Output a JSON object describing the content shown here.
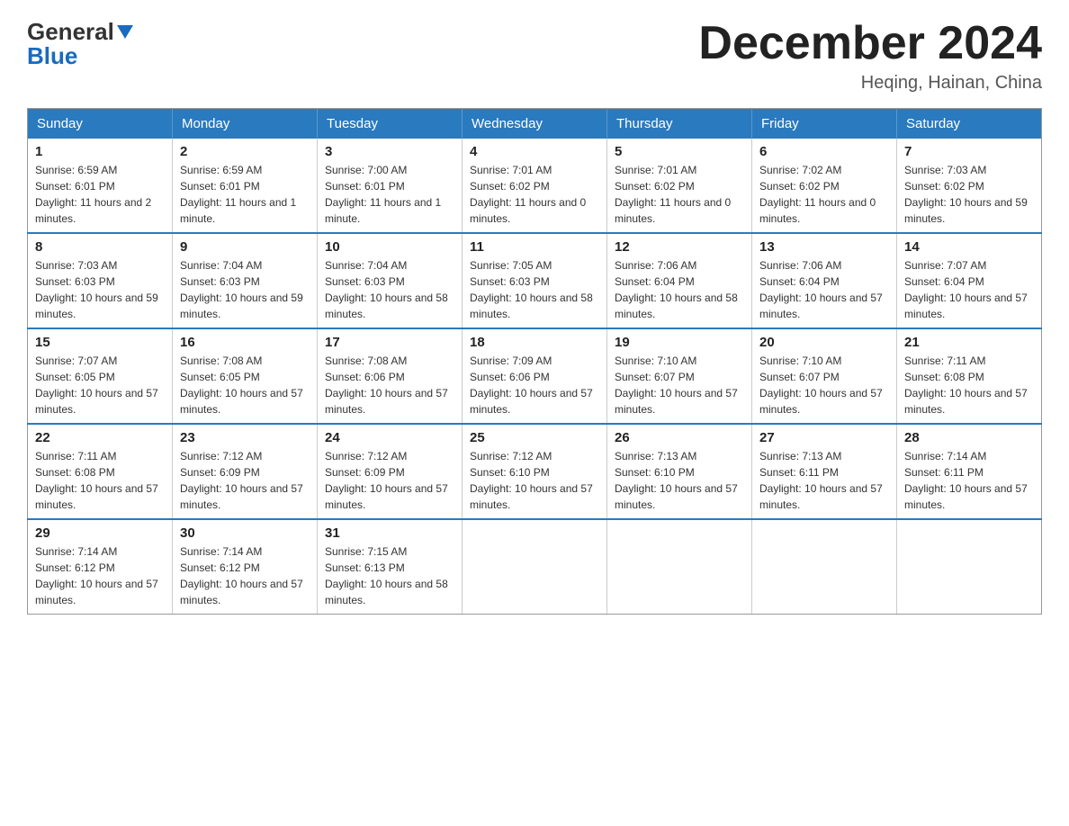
{
  "logo": {
    "line1_black": "General",
    "line1_blue_triangle": "▶",
    "line2": "Blue"
  },
  "title": "December 2024",
  "subtitle": "Heqing, Hainan, China",
  "days_of_week": [
    "Sunday",
    "Monday",
    "Tuesday",
    "Wednesday",
    "Thursday",
    "Friday",
    "Saturday"
  ],
  "weeks": [
    [
      {
        "day": "1",
        "sunrise": "6:59 AM",
        "sunset": "6:01 PM",
        "daylight": "11 hours and 2 minutes."
      },
      {
        "day": "2",
        "sunrise": "6:59 AM",
        "sunset": "6:01 PM",
        "daylight": "11 hours and 1 minute."
      },
      {
        "day": "3",
        "sunrise": "7:00 AM",
        "sunset": "6:01 PM",
        "daylight": "11 hours and 1 minute."
      },
      {
        "day": "4",
        "sunrise": "7:01 AM",
        "sunset": "6:02 PM",
        "daylight": "11 hours and 0 minutes."
      },
      {
        "day": "5",
        "sunrise": "7:01 AM",
        "sunset": "6:02 PM",
        "daylight": "11 hours and 0 minutes."
      },
      {
        "day": "6",
        "sunrise": "7:02 AM",
        "sunset": "6:02 PM",
        "daylight": "11 hours and 0 minutes."
      },
      {
        "day": "7",
        "sunrise": "7:03 AM",
        "sunset": "6:02 PM",
        "daylight": "10 hours and 59 minutes."
      }
    ],
    [
      {
        "day": "8",
        "sunrise": "7:03 AM",
        "sunset": "6:03 PM",
        "daylight": "10 hours and 59 minutes."
      },
      {
        "day": "9",
        "sunrise": "7:04 AM",
        "sunset": "6:03 PM",
        "daylight": "10 hours and 59 minutes."
      },
      {
        "day": "10",
        "sunrise": "7:04 AM",
        "sunset": "6:03 PM",
        "daylight": "10 hours and 58 minutes."
      },
      {
        "day": "11",
        "sunrise": "7:05 AM",
        "sunset": "6:03 PM",
        "daylight": "10 hours and 58 minutes."
      },
      {
        "day": "12",
        "sunrise": "7:06 AM",
        "sunset": "6:04 PM",
        "daylight": "10 hours and 58 minutes."
      },
      {
        "day": "13",
        "sunrise": "7:06 AM",
        "sunset": "6:04 PM",
        "daylight": "10 hours and 57 minutes."
      },
      {
        "day": "14",
        "sunrise": "7:07 AM",
        "sunset": "6:04 PM",
        "daylight": "10 hours and 57 minutes."
      }
    ],
    [
      {
        "day": "15",
        "sunrise": "7:07 AM",
        "sunset": "6:05 PM",
        "daylight": "10 hours and 57 minutes."
      },
      {
        "day": "16",
        "sunrise": "7:08 AM",
        "sunset": "6:05 PM",
        "daylight": "10 hours and 57 minutes."
      },
      {
        "day": "17",
        "sunrise": "7:08 AM",
        "sunset": "6:06 PM",
        "daylight": "10 hours and 57 minutes."
      },
      {
        "day": "18",
        "sunrise": "7:09 AM",
        "sunset": "6:06 PM",
        "daylight": "10 hours and 57 minutes."
      },
      {
        "day": "19",
        "sunrise": "7:10 AM",
        "sunset": "6:07 PM",
        "daylight": "10 hours and 57 minutes."
      },
      {
        "day": "20",
        "sunrise": "7:10 AM",
        "sunset": "6:07 PM",
        "daylight": "10 hours and 57 minutes."
      },
      {
        "day": "21",
        "sunrise": "7:11 AM",
        "sunset": "6:08 PM",
        "daylight": "10 hours and 57 minutes."
      }
    ],
    [
      {
        "day": "22",
        "sunrise": "7:11 AM",
        "sunset": "6:08 PM",
        "daylight": "10 hours and 57 minutes."
      },
      {
        "day": "23",
        "sunrise": "7:12 AM",
        "sunset": "6:09 PM",
        "daylight": "10 hours and 57 minutes."
      },
      {
        "day": "24",
        "sunrise": "7:12 AM",
        "sunset": "6:09 PM",
        "daylight": "10 hours and 57 minutes."
      },
      {
        "day": "25",
        "sunrise": "7:12 AM",
        "sunset": "6:10 PM",
        "daylight": "10 hours and 57 minutes."
      },
      {
        "day": "26",
        "sunrise": "7:13 AM",
        "sunset": "6:10 PM",
        "daylight": "10 hours and 57 minutes."
      },
      {
        "day": "27",
        "sunrise": "7:13 AM",
        "sunset": "6:11 PM",
        "daylight": "10 hours and 57 minutes."
      },
      {
        "day": "28",
        "sunrise": "7:14 AM",
        "sunset": "6:11 PM",
        "daylight": "10 hours and 57 minutes."
      }
    ],
    [
      {
        "day": "29",
        "sunrise": "7:14 AM",
        "sunset": "6:12 PM",
        "daylight": "10 hours and 57 minutes."
      },
      {
        "day": "30",
        "sunrise": "7:14 AM",
        "sunset": "6:12 PM",
        "daylight": "10 hours and 57 minutes."
      },
      {
        "day": "31",
        "sunrise": "7:15 AM",
        "sunset": "6:13 PM",
        "daylight": "10 hours and 58 minutes."
      },
      null,
      null,
      null,
      null
    ]
  ],
  "labels": {
    "sunrise": "Sunrise:",
    "sunset": "Sunset:",
    "daylight": "Daylight:"
  }
}
